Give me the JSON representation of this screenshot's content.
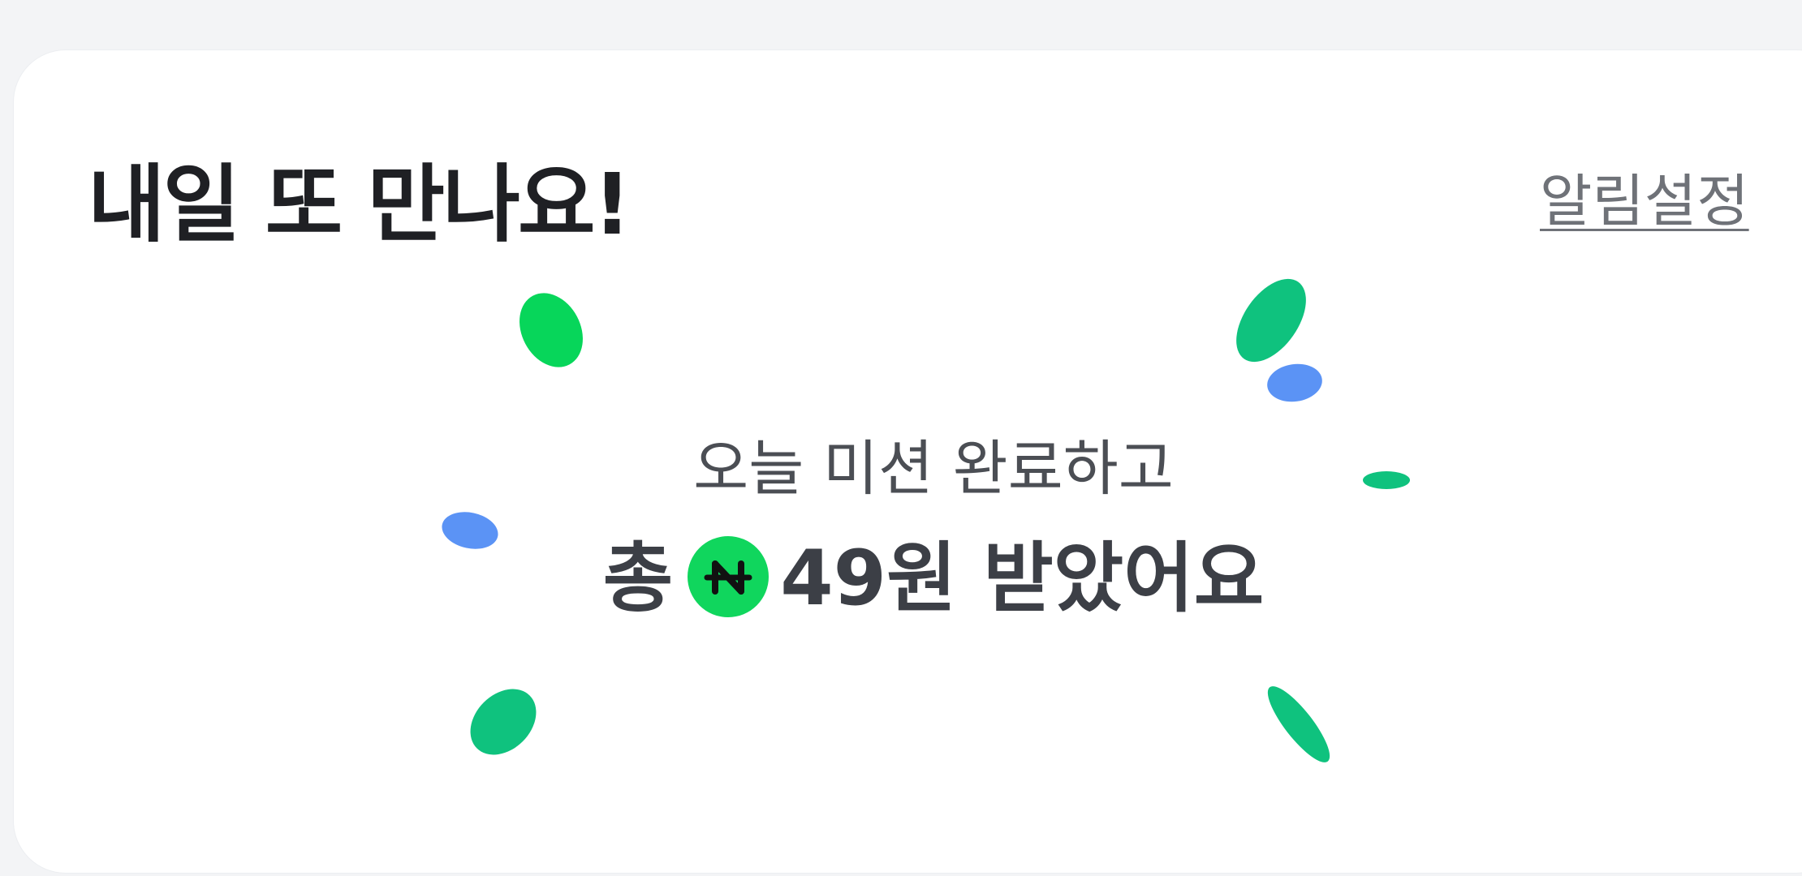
{
  "card": {
    "title": "내일 또 만나요!",
    "alarm_setting_link": "알림설정"
  },
  "reward": {
    "subtitle": "오늘 미션 완료하고",
    "prefix": "총",
    "coin_icon": "naver-pay-coin-icon",
    "amount_text": "49원 받았어요"
  },
  "colors": {
    "confetti_green": "#0fc27e",
    "confetti_bright_green": "#07d65a",
    "confetti_blue": "#5b93f5",
    "coin": "#10d65d"
  }
}
